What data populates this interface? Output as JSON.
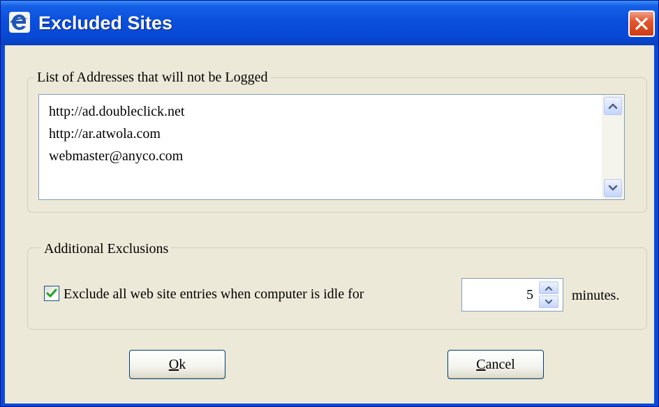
{
  "window": {
    "title": "Excluded Sites",
    "close_icon": "close-x-icon",
    "app_icon": "app-e-logo-icon"
  },
  "address_group": {
    "legend": "List of Addresses that will not be Logged",
    "items": [
      "http://ad.doubleclick.net",
      "http://ar.atwola.com",
      "webmaster@anyco.com"
    ],
    "scroll_up_icon": "chevron-up-icon",
    "scroll_down_icon": "chevron-down-icon"
  },
  "exclusions_group": {
    "legend": "Additional Exclusions",
    "checkbox_checked": true,
    "checkbox_label": "Exclude all web site entries when computer is idle for",
    "idle_value": "5",
    "units_label": "minutes."
  },
  "buttons": {
    "ok_mnemonic": "O",
    "ok_rest": "k",
    "cancel_mnemonic": "C",
    "cancel_rest": "ancel"
  },
  "colors": {
    "title_bar": "#0a49d8",
    "client_bg": "#ece9d8",
    "close_button": "#e2582e",
    "check_mark": "#21a121"
  }
}
